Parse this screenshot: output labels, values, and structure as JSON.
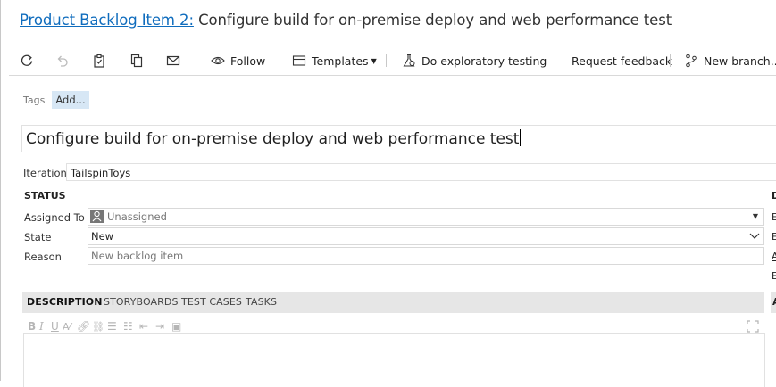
{
  "header": {
    "link": "Product Backlog Item 2:",
    "title": "Configure build for on-premise deploy and web performance test"
  },
  "toolbar": {
    "refresh_icon": "refresh-icon",
    "undo_icon": "undo-icon",
    "clipboard_icon": "clipboard-icon",
    "copy_icon": "copy-icon",
    "email_icon": "mail-icon",
    "follow": "Follow",
    "templates": "Templates",
    "exploratory": "Do exploratory testing",
    "request_feedback": "Request feedback",
    "new_branch": "New branch..."
  },
  "tags": {
    "label": "Tags",
    "add": "Add..."
  },
  "work_item": {
    "title_value": "Configure build for on-premise deploy and web performance test"
  },
  "iteration": {
    "label": "Iteration",
    "value": "TailspinToys"
  },
  "status": {
    "heading": "STATUS",
    "assigned_to": {
      "label": "Assigned To",
      "value": "Unassigned"
    },
    "state": {
      "label": "State",
      "value": "New"
    },
    "reason": {
      "label": "Reason",
      "value": "New backlog item"
    }
  },
  "right_column": {
    "heading": "D",
    "l1": "E",
    "l2": "E",
    "l3": "A",
    "l4": "E"
  },
  "tabs": [
    "DESCRIPTION",
    "STORYBOARDS",
    "TEST CASES",
    "TASKS"
  ],
  "right_tab": "A",
  "colors": {
    "link": "#0f6cbd",
    "tag_bg": "#d7e7f5",
    "tab_bg": "#e6e6e6"
  }
}
